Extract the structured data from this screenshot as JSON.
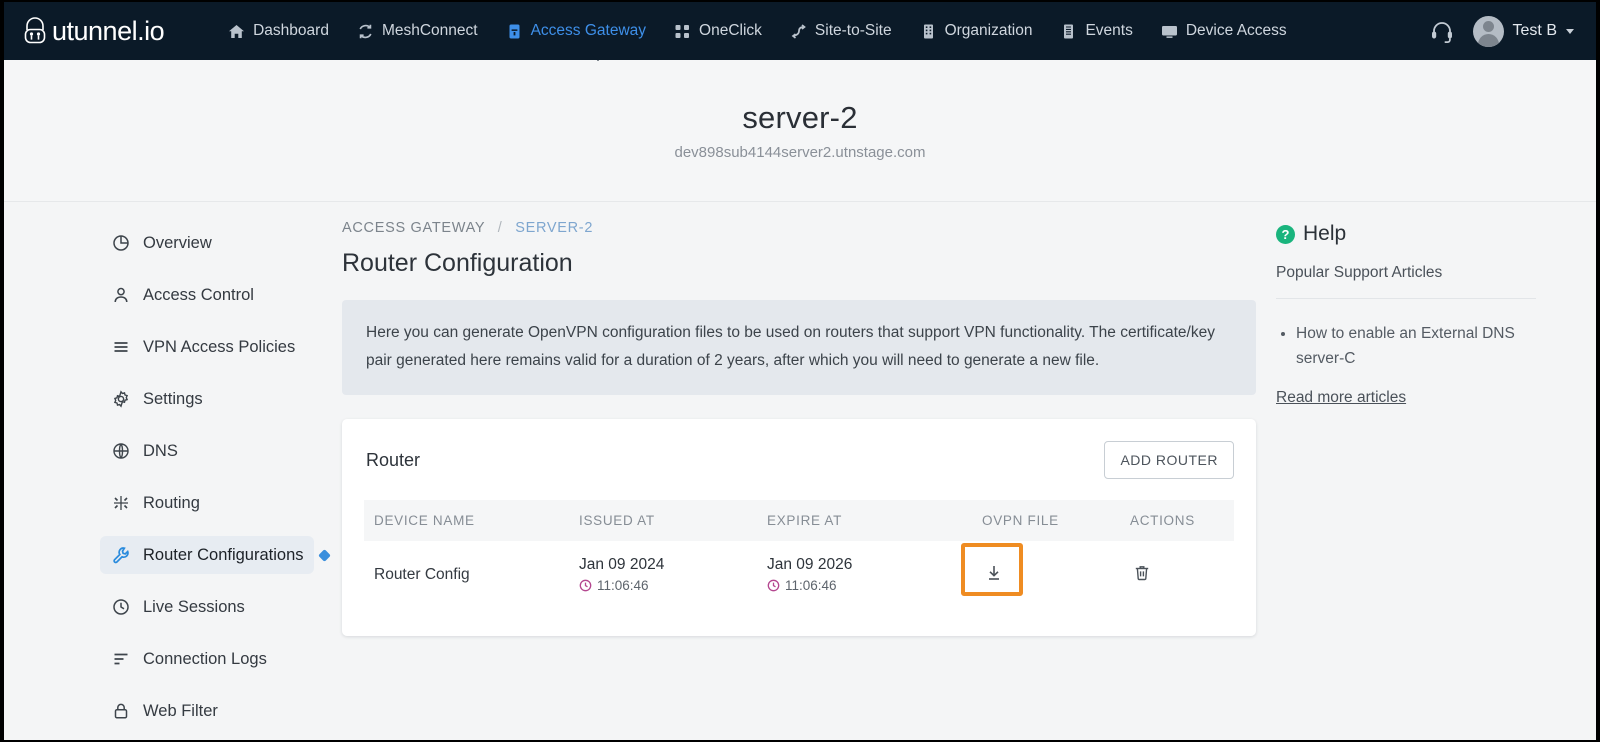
{
  "navbar": {
    "logo_text": "utunnel.io",
    "logo_icon": "lock-shield-icon",
    "items": [
      {
        "label": "Dashboard",
        "icon": "home-icon",
        "active": false
      },
      {
        "label": "MeshConnect",
        "icon": "mesh-icon",
        "active": false
      },
      {
        "label": "Access Gateway",
        "icon": "gateway-icon",
        "active": true
      },
      {
        "label": "OneClick",
        "icon": "oneclick-icon",
        "active": false
      },
      {
        "label": "Site-to-Site",
        "icon": "site-to-site-icon",
        "active": false
      },
      {
        "label": "Organization",
        "icon": "building-icon",
        "active": false
      },
      {
        "label": "Events",
        "icon": "events-icon",
        "active": false
      },
      {
        "label": "Device Access",
        "icon": "monitor-icon",
        "active": false
      }
    ],
    "support_icon": "headset-icon",
    "user": {
      "name": "Test B",
      "avatar": "avatar",
      "caret": "chevron-down-icon"
    },
    "active_color": "#3e8fe8",
    "bg_color": "#0b1a28"
  },
  "page_header": {
    "title": "server-2",
    "subtitle": "dev898sub4144server2.utnstage.com"
  },
  "sidebar": {
    "items": [
      {
        "label": "Overview",
        "icon": "pie-chart-icon",
        "active": false
      },
      {
        "label": "Access Control",
        "icon": "user-icon",
        "active": false
      },
      {
        "label": "VPN Access Policies",
        "icon": "list-icon",
        "active": false
      },
      {
        "label": "Settings",
        "icon": "gear-icon",
        "active": false
      },
      {
        "label": "DNS",
        "icon": "globe-icon",
        "active": false
      },
      {
        "label": "Routing",
        "icon": "routing-icon",
        "active": false
      },
      {
        "label": "Router Configurations",
        "icon": "wrench-icon",
        "active": true
      },
      {
        "label": "Live Sessions",
        "icon": "clock-icon",
        "active": false
      },
      {
        "label": "Connection Logs",
        "icon": "logs-icon",
        "active": false
      },
      {
        "label": "Web Filter",
        "icon": "lock-icon",
        "active": false
      }
    ],
    "active_accent": "#2a8bdd"
  },
  "main": {
    "breadcrumb": {
      "root": "ACCESS GATEWAY",
      "separator": "/",
      "current": "SERVER-2"
    },
    "title": "Router Configuration",
    "notice": "Here you can generate OpenVPN configuration files to be used on routers that support VPN functionality. The certificate/key pair generated here remains valid for a duration of 2 years, after which you will need to generate a new file.",
    "card": {
      "title": "Router",
      "add_button": "ADD ROUTER",
      "table": {
        "headers": [
          "DEVICE NAME",
          "ISSUED AT",
          "EXPIRE AT",
          "OVPN FILE",
          "ACTIONS"
        ],
        "rows": [
          {
            "device_name": "Router Config",
            "issued_date": "Jan 09 2024",
            "issued_time": "11:06:46",
            "expire_date": "Jan 09 2026",
            "expire_time": "11:06:46",
            "ovpn_icon": "download-icon",
            "action_icon": "trash-icon",
            "highlighted": true
          }
        ]
      }
    }
  },
  "help": {
    "title": "Help",
    "title_icon": "question-circle-icon",
    "subtitle": "Popular Support Articles",
    "articles": [
      "How to enable an External DNS server-C"
    ],
    "read_more": "Read more articles",
    "accent": "#19b47d"
  },
  "highlight_color": "#ef8c22"
}
